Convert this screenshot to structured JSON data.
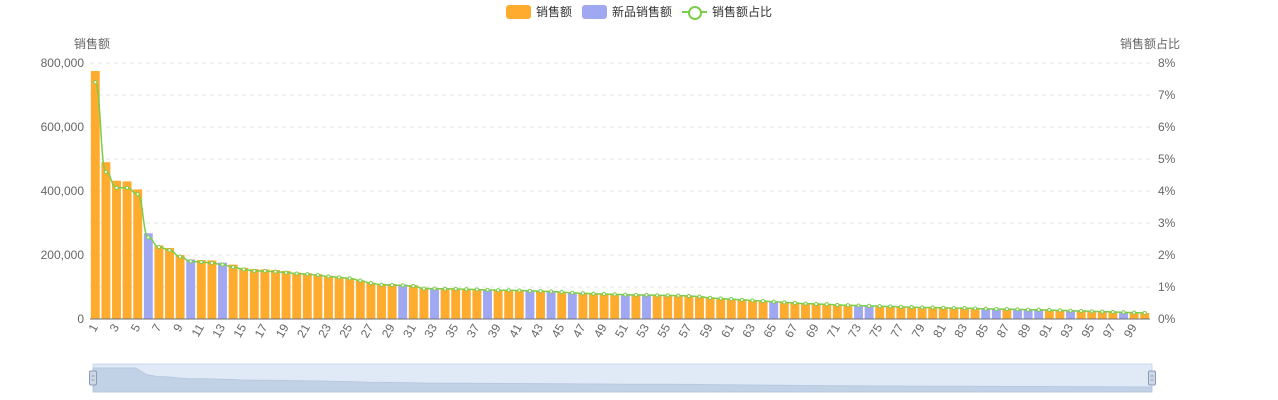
{
  "legend": {
    "sales": "销售额",
    "new_sales": "新品销售额",
    "ratio": "销售额占比"
  },
  "chart_data": {
    "type": "bar",
    "ylabel_left": "销售额",
    "ylabel_right": "销售额占比",
    "ylim_left": [
      0,
      800000
    ],
    "ylim_right": [
      0,
      8
    ],
    "left_ticks": [
      "0",
      "200,000",
      "400,000",
      "600,000",
      "800,000"
    ],
    "right_ticks": [
      "0%",
      "1%",
      "2%",
      "3%",
      "4%",
      "5%",
      "6%",
      "7%",
      "8%"
    ],
    "grid": true,
    "legend_position": "top-center",
    "colors": {
      "sales": "#ffab2e",
      "new_sales": "#a1a8f2",
      "ratio_line": "#7ccd4a",
      "slider_fill": "#dfe5ef"
    },
    "x": [
      1,
      2,
      3,
      4,
      5,
      6,
      7,
      8,
      9,
      10,
      11,
      12,
      13,
      14,
      15,
      16,
      17,
      18,
      19,
      20,
      21,
      22,
      23,
      24,
      25,
      26,
      27,
      28,
      29,
      30,
      31,
      32,
      33,
      34,
      35,
      36,
      37,
      38,
      39,
      40,
      41,
      42,
      43,
      44,
      45,
      46,
      47,
      48,
      49,
      50,
      51,
      52,
      53,
      54,
      55,
      56,
      57,
      58,
      59,
      60,
      61,
      62,
      63,
      64,
      65,
      66,
      67,
      68,
      69,
      70,
      71,
      72,
      73,
      74,
      75,
      76,
      77,
      78,
      79,
      80,
      81,
      82,
      83,
      84,
      85,
      86,
      87,
      88,
      89,
      90,
      91,
      92,
      93,
      94,
      95,
      96,
      97,
      98,
      99,
      100
    ],
    "values": [
      775000,
      490000,
      432000,
      430000,
      405000,
      268000,
      230000,
      222000,
      200000,
      186000,
      184000,
      183000,
      176000,
      170000,
      160000,
      156000,
      155000,
      153000,
      150000,
      145000,
      143000,
      140000,
      135000,
      131000,
      128000,
      120000,
      113000,
      110000,
      109000,
      108000,
      106000,
      98000,
      97000,
      96000,
      95000,
      94000,
      93000,
      92000,
      91000,
      90000,
      89000,
      88000,
      87000,
      86000,
      84000,
      82000,
      80000,
      79000,
      78000,
      77000,
      76000,
      75000,
      75000,
      74000,
      74000,
      73000,
      72000,
      70000,
      66000,
      64000,
      62000,
      60000,
      58000,
      56000,
      54000,
      52000,
      50000,
      48000,
      47000,
      46000,
      44000,
      43000,
      42000,
      41000,
      40000,
      39000,
      38000,
      37000,
      36000,
      36000,
      35000,
      34000,
      34000,
      33000,
      32000,
      31000,
      31000,
      30000,
      29000,
      29000,
      28000,
      27000,
      26000,
      25000,
      24000,
      23000,
      22000,
      21000,
      20000,
      19000
    ],
    "new_product_indices": [
      6,
      10,
      13,
      30,
      33,
      38,
      42,
      44,
      46,
      51,
      53,
      65,
      73,
      74,
      85,
      86,
      88,
      89,
      90,
      93,
      98
    ],
    "ratio_percent": [
      7.4,
      4.6,
      4.1,
      4.1,
      3.9,
      2.55,
      2.25,
      2.15,
      1.95,
      1.8,
      1.78,
      1.75,
      1.7,
      1.62,
      1.55,
      1.5,
      1.5,
      1.48,
      1.45,
      1.42,
      1.4,
      1.37,
      1.33,
      1.3,
      1.27,
      1.2,
      1.12,
      1.07,
      1.06,
      1.05,
      1.03,
      0.95,
      0.95,
      0.94,
      0.94,
      0.93,
      0.92,
      0.91,
      0.9,
      0.9,
      0.89,
      0.88,
      0.87,
      0.86,
      0.84,
      0.82,
      0.8,
      0.79,
      0.78,
      0.77,
      0.76,
      0.75,
      0.75,
      0.74,
      0.74,
      0.73,
      0.72,
      0.7,
      0.66,
      0.64,
      0.62,
      0.6,
      0.58,
      0.56,
      0.54,
      0.52,
      0.5,
      0.48,
      0.47,
      0.46,
      0.44,
      0.43,
      0.42,
      0.41,
      0.4,
      0.39,
      0.38,
      0.37,
      0.36,
      0.36,
      0.35,
      0.34,
      0.34,
      0.33,
      0.32,
      0.31,
      0.31,
      0.3,
      0.29,
      0.29,
      0.28,
      0.27,
      0.26,
      0.25,
      0.24,
      0.23,
      0.22,
      0.21,
      0.2,
      0.19
    ]
  }
}
